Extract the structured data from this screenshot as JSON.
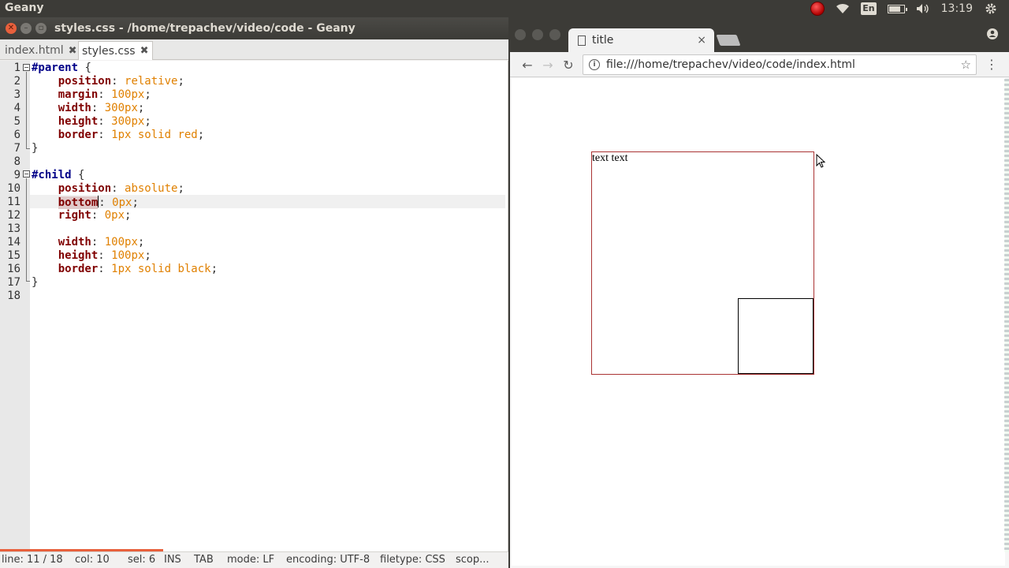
{
  "top_panel": {
    "app_name": "Geany",
    "language": "En",
    "clock": "13:19",
    "battery_level": 0.7
  },
  "geany": {
    "title": "styles.css - /home/trepachev/video/code - Geany",
    "tabs": [
      {
        "label": "index.html",
        "active": false
      },
      {
        "label": "styles.css",
        "active": true
      }
    ],
    "line_numbers": [
      "1",
      "2",
      "3",
      "4",
      "5",
      "6",
      "7",
      "8",
      "9",
      "10",
      "11",
      "12",
      "13",
      "14",
      "15",
      "16",
      "17",
      "18"
    ],
    "code": {
      "l1_sel": "#parent",
      "l1_rest": " {",
      "l2_prop": "position",
      "l2_val": "relative",
      "l3_prop": "margin",
      "l3_val": "100px",
      "l4_prop": "width",
      "l4_val": "300px",
      "l5_prop": "height",
      "l5_val": "300px",
      "l6_prop": "border",
      "l6_val": "1px solid red",
      "l7": "}",
      "l9_sel": "#child",
      "l9_rest": " {",
      "l10_prop": "position",
      "l10_val": "absolute",
      "l11_prop_hl": "bottom",
      "l11_val": "0px",
      "l12_prop": "right",
      "l12_val": "0px",
      "l14_prop": "width",
      "l14_val": "100px",
      "l15_prop": "height",
      "l15_val": "100px",
      "l16_prop": "border",
      "l16_val": "1px solid black",
      "l17": "}"
    },
    "status": {
      "line": "line: 11 / 18",
      "col": "col: 10",
      "sel": "sel: 6",
      "ins": "INS",
      "tab": "TAB",
      "mode": "mode: LF",
      "encoding": "encoding: UTF-8",
      "filetype": "filetype: CSS",
      "scope": "scop..."
    }
  },
  "chrome": {
    "tab_title": "title",
    "url": "file:///home/trepachev/video/code/index.html",
    "page_text": "text text"
  },
  "icons": {
    "back": "←",
    "forward": "→",
    "reload": "↻",
    "star": "☆",
    "menu": "⋮",
    "close": "×",
    "wifi": "wifi-icon",
    "volume": "volume-icon",
    "settings": "gear-icon"
  }
}
